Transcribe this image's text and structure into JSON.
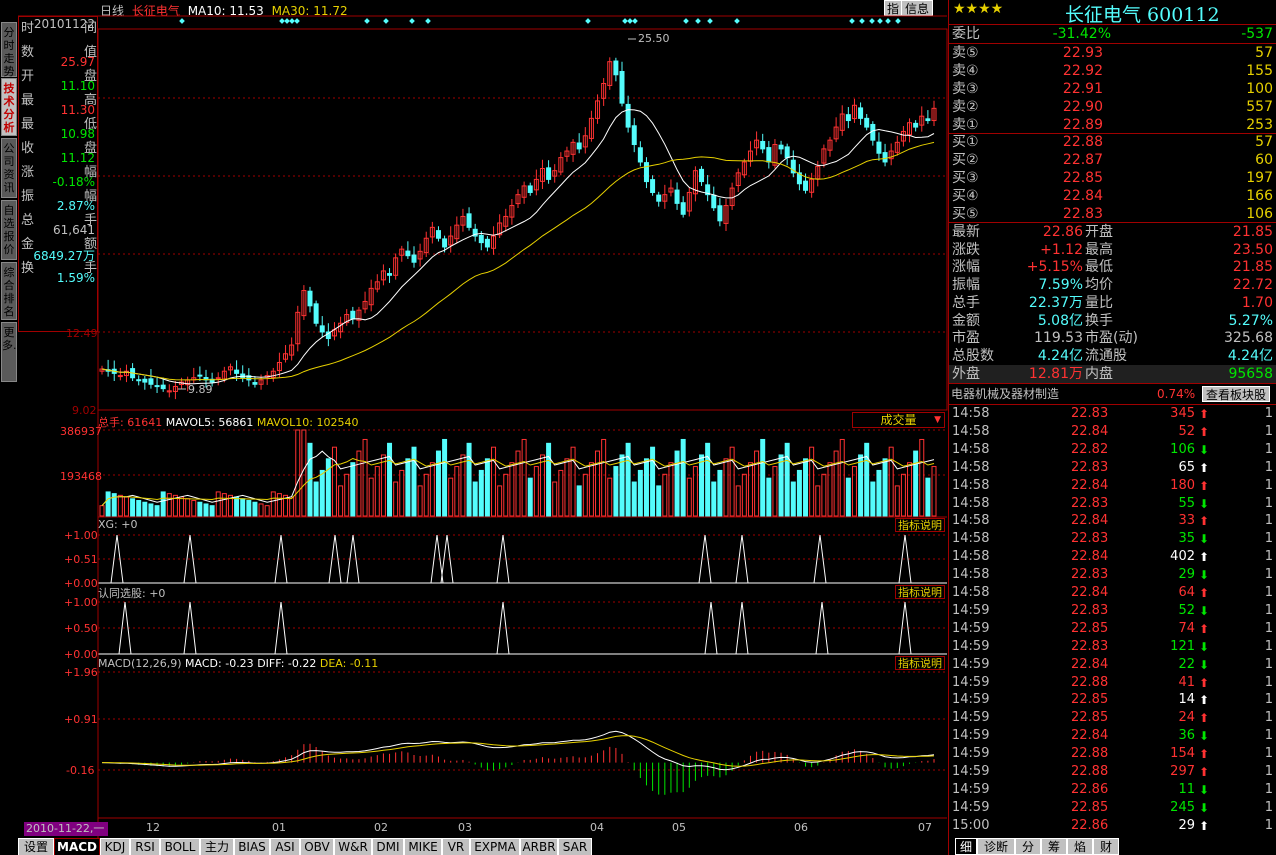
{
  "colors": {
    "up": "#ff3232",
    "down": "#54fcfc",
    "yellow": "#e6d000",
    "green": "#00e600",
    "white": "#ffffff",
    "gray": "#c0c0c0",
    "grid": "#a00000",
    "purple": "#800080"
  },
  "vtabs": [
    "分时走势",
    "技术分析",
    "公司资讯",
    "自选报价",
    "综合排名",
    "更多..."
  ],
  "info": {
    "rows": [
      {
        "k1": "时",
        "k2": "间",
        "v": "20101122",
        "c": "#c0c0c0"
      },
      {
        "k1": "数",
        "k2": "值",
        "v": "25.97",
        "c": "#ff3232"
      },
      {
        "k1": "开",
        "k2": "盘",
        "v": "11.10",
        "c": "#00e600"
      },
      {
        "k1": "最",
        "k2": "高",
        "v": "11.30",
        "c": "#ff3232"
      },
      {
        "k1": "最",
        "k2": "低",
        "v": "10.98",
        "c": "#00e600"
      },
      {
        "k1": "收",
        "k2": "盘",
        "v": "11.12",
        "c": "#00e600"
      },
      {
        "k1": "涨",
        "k2": "幅",
        "v": "-0.18%",
        "c": "#00e600"
      },
      {
        "k1": "振",
        "k2": "幅",
        "v": "2.87%",
        "c": "#54fcfc"
      },
      {
        "k1": "总",
        "k2": "手",
        "v": "61,641",
        "c": "#c0c0c0"
      },
      {
        "k1": "金",
        "k2": "额",
        "v": "6849.27万",
        "c": "#54fcfc"
      },
      {
        "k1": "换",
        "k2": "手",
        "v": "1.59%",
        "c": "#54fcfc"
      }
    ]
  },
  "topbar": {
    "period": "日线",
    "name": "长征电气",
    "ma10": "MA10: 11.53",
    "ma30": "MA30: 11.72",
    "btn_zhi": "指",
    "btn_info": "信息"
  },
  "price_axis": {
    "labels": [
      "12.49",
      "9.02"
    ]
  },
  "annotations": {
    "high": "25.50",
    "low": "9.89"
  },
  "vol": {
    "label": "总手: 61641",
    "mavol5": "MAVOL5: 56861",
    "mavol10": "MAVOL10: 102540",
    "axis": [
      "386937",
      "193468"
    ],
    "dropdown": "成交量"
  },
  "xg": {
    "label": "XG: +0",
    "axis": [
      "+1.00",
      "+0.51",
      "+0.00"
    ],
    "explain": "指标说明"
  },
  "rt": {
    "label": "认同选股: +0",
    "axis": [
      "+1.00",
      "+0.50",
      "+0.00"
    ],
    "explain": "指标说明"
  },
  "macd": {
    "label": "MACD(12,26,9)",
    "macd": "MACD: -0.23",
    "diff": "DIFF: -0.22",
    "dea": "DEA: -0.11",
    "axis": [
      "+1.96",
      "+0.91",
      "-0.16"
    ],
    "explain": "指标说明"
  },
  "xaxis": {
    "date_box": "2010-11-22,一",
    "months": [
      "12",
      "01",
      "02",
      "03",
      "04",
      "05",
      "06",
      "07"
    ]
  },
  "bottom_tabs": [
    "设置",
    "MACD",
    "KDJ",
    "RSI",
    "BOLL",
    "主力",
    "BIAS",
    "ASI",
    "OBV",
    "W&R",
    "DMI",
    "MIKE",
    "VR",
    "EXPMA",
    "ARBR",
    "SAR"
  ],
  "stock": {
    "stars": "★★★★",
    "title": "长征电气 600112"
  },
  "weibi": {
    "label": "委比",
    "pct": "-31.42%",
    "val": "-537"
  },
  "sells": [
    {
      "l": "卖⑤",
      "p": "22.93",
      "v": "57"
    },
    {
      "l": "卖④",
      "p": "22.92",
      "v": "155"
    },
    {
      "l": "卖③",
      "p": "22.91",
      "v": "100"
    },
    {
      "l": "卖②",
      "p": "22.90",
      "v": "557"
    },
    {
      "l": "卖①",
      "p": "22.89",
      "v": "253"
    }
  ],
  "buys": [
    {
      "l": "买①",
      "p": "22.88",
      "v": "57"
    },
    {
      "l": "买②",
      "p": "22.87",
      "v": "60"
    },
    {
      "l": "买③",
      "p": "22.85",
      "v": "197"
    },
    {
      "l": "买④",
      "p": "22.84",
      "v": "166"
    },
    {
      "l": "买⑤",
      "p": "22.83",
      "v": "106"
    }
  ],
  "quote": [
    {
      "l": "最新",
      "v": "22.86",
      "c": "#ff3232",
      "l2": "开盘",
      "v2": "21.85",
      "c2": "#ff3232"
    },
    {
      "l": "涨跌",
      "v": "+1.12",
      "c": "#ff3232",
      "l2": "最高",
      "v2": "23.50",
      "c2": "#ff3232"
    },
    {
      "l": "涨幅",
      "v": "+5.15%",
      "c": "#ff3232",
      "l2": "最低",
      "v2": "21.85",
      "c2": "#ff3232"
    },
    {
      "l": "振幅",
      "v": "7.59%",
      "c": "#54fcfc",
      "l2": "均价",
      "v2": "22.72",
      "c2": "#ff3232"
    },
    {
      "l": "总手",
      "v": "22.37万",
      "c": "#54fcfc",
      "l2": "量比",
      "v2": "1.70",
      "c2": "#ff3232"
    },
    {
      "l": "金额",
      "v": "5.08亿",
      "c": "#54fcfc",
      "l2": "换手",
      "v2": "5.27%",
      "c2": "#54fcfc"
    },
    {
      "l": "市盈",
      "v": "119.53",
      "c": "#c0c0c0",
      "l2": "市盈(动)",
      "v2": "325.68",
      "c2": "#c0c0c0"
    },
    {
      "l": "总股数",
      "v": "4.24亿",
      "c": "#54fcfc",
      "l2": "流通股",
      "v2": "4.24亿",
      "c2": "#54fcfc"
    },
    {
      "l": "外盘",
      "v": "12.81万",
      "c": "#ff3232",
      "l2": "内盘",
      "v2": "95658",
      "c2": "#00e600"
    }
  ],
  "sector": {
    "name": "电器机械及器材制造",
    "pct": "0.74%",
    "button": "查看板块股"
  },
  "ticks": [
    {
      "t": "14:58",
      "p": "22.83",
      "v": "345",
      "d": "up",
      "n": "1"
    },
    {
      "t": "14:58",
      "p": "22.84",
      "v": "52",
      "d": "up",
      "n": "1"
    },
    {
      "t": "14:58",
      "p": "22.82",
      "v": "106",
      "d": "down",
      "n": "1"
    },
    {
      "t": "14:58",
      "p": "22.83",
      "v": "65",
      "d": "upw",
      "n": "1"
    },
    {
      "t": "14:58",
      "p": "22.84",
      "v": "180",
      "d": "up",
      "n": "1"
    },
    {
      "t": "14:58",
      "p": "22.83",
      "v": "55",
      "d": "down",
      "n": "1"
    },
    {
      "t": "14:58",
      "p": "22.84",
      "v": "33",
      "d": "up",
      "n": "1"
    },
    {
      "t": "14:58",
      "p": "22.83",
      "v": "35",
      "d": "down",
      "n": "1"
    },
    {
      "t": "14:58",
      "p": "22.84",
      "v": "402",
      "d": "upw",
      "n": "1"
    },
    {
      "t": "14:58",
      "p": "22.83",
      "v": "29",
      "d": "down",
      "n": "1"
    },
    {
      "t": "14:58",
      "p": "22.84",
      "v": "64",
      "d": "up",
      "n": "1"
    },
    {
      "t": "14:59",
      "p": "22.83",
      "v": "52",
      "d": "down",
      "n": "1"
    },
    {
      "t": "14:59",
      "p": "22.85",
      "v": "74",
      "d": "up",
      "n": "1"
    },
    {
      "t": "14:59",
      "p": "22.83",
      "v": "121",
      "d": "down",
      "n": "1"
    },
    {
      "t": "14:59",
      "p": "22.84",
      "v": "22",
      "d": "down",
      "n": "1"
    },
    {
      "t": "14:59",
      "p": "22.88",
      "v": "41",
      "d": "up",
      "n": "1"
    },
    {
      "t": "14:59",
      "p": "22.85",
      "v": "14",
      "d": "upw",
      "n": "1"
    },
    {
      "t": "14:59",
      "p": "22.85",
      "v": "24",
      "d": "up",
      "n": "1"
    },
    {
      "t": "14:59",
      "p": "22.84",
      "v": "36",
      "d": "down",
      "n": "1"
    },
    {
      "t": "14:59",
      "p": "22.88",
      "v": "154",
      "d": "up",
      "n": "1"
    },
    {
      "t": "14:59",
      "p": "22.88",
      "v": "297",
      "d": "up",
      "n": "1"
    },
    {
      "t": "14:59",
      "p": "22.86",
      "v": "11",
      "d": "down",
      "n": "1"
    },
    {
      "t": "14:59",
      "p": "22.85",
      "v": "245",
      "d": "down",
      "n": "1"
    },
    {
      "t": "15:00",
      "p": "22.86",
      "v": "29",
      "d": "upw",
      "n": "1"
    }
  ],
  "right_tabs": [
    "细",
    "诊断",
    "分",
    "筹",
    "焰",
    "财"
  ],
  "chart_data": {
    "type": "candlestick",
    "ylim": [
      9.02,
      26.5
    ],
    "title": "",
    "closes": [
      10.9,
      10.8,
      10.7,
      10.6,
      10.8,
      10.5,
      10.4,
      10.3,
      10.2,
      10.1,
      10.0,
      9.9,
      10.1,
      10.3,
      10.4,
      10.5,
      10.6,
      10.4,
      10.3,
      10.5,
      10.8,
      11.0,
      10.7,
      10.5,
      10.4,
      10.2,
      10.4,
      10.6,
      10.8,
      11.2,
      11.6,
      12.0,
      13.5,
      14.5,
      13.8,
      13.0,
      12.6,
      12.3,
      12.7,
      13.0,
      13.4,
      13.2,
      13.6,
      14.0,
      14.6,
      14.9,
      15.4,
      15.2,
      16.0,
      16.4,
      16.1,
      15.8,
      16.3,
      16.9,
      17.4,
      16.9,
      16.5,
      17.0,
      17.5,
      17.9,
      17.4,
      17.0,
      16.7,
      16.5,
      17.0,
      17.6,
      17.9,
      18.4,
      18.9,
      19.3,
      19.0,
      19.6,
      20.1,
      19.6,
      20.0,
      20.6,
      20.9,
      21.3,
      21.0,
      21.6,
      22.4,
      23.2,
      24.0,
      25.0,
      24.4,
      23.1,
      22.0,
      21.2,
      20.4,
      19.5,
      19.0,
      18.6,
      18.9,
      19.2,
      18.5,
      18.0,
      19.0,
      20.0,
      19.5,
      18.9,
      18.3,
      17.7,
      18.4,
      19.2,
      19.9,
      20.4,
      20.9,
      21.4,
      21.0,
      20.4,
      21.2,
      21.0,
      20.6,
      19.9,
      19.4,
      19.1,
      19.6,
      20.2,
      21.0,
      21.4,
      22.0,
      22.6,
      22.3,
      23.0,
      22.4,
      22.0,
      21.4,
      20.8,
      20.4,
      20.9,
      21.3,
      21.8,
      22.2,
      22.0,
      22.5,
      22.3,
      22.86
    ],
    "ma10_last": 11.53,
    "ma30_last": 11.72,
    "high": 25.5,
    "low": 9.89
  }
}
